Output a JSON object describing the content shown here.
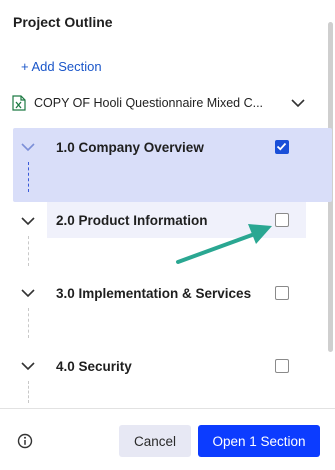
{
  "header": {
    "title": "Project Outline"
  },
  "actions": {
    "add_section": "+ Add Section"
  },
  "file": {
    "name": "COPY OF Hooli Questionnaire Mixed C...",
    "icon": "excel-file-icon"
  },
  "sections": [
    {
      "label": "1.0 Company Overview",
      "checked": true,
      "expanded": true
    },
    {
      "label": "2.0 Product Information",
      "checked": false,
      "expanded": true
    },
    {
      "label": "3.0 Implementation & Services",
      "checked": false,
      "expanded": true
    },
    {
      "label": "4.0 Security",
      "checked": false,
      "expanded": true
    }
  ],
  "footer": {
    "cancel_label": "Cancel",
    "open_label": "Open 1 Section"
  },
  "colors": {
    "accent": "#0c3cff",
    "selected_bg": "#d9def9",
    "arrow": "#2aa792"
  }
}
